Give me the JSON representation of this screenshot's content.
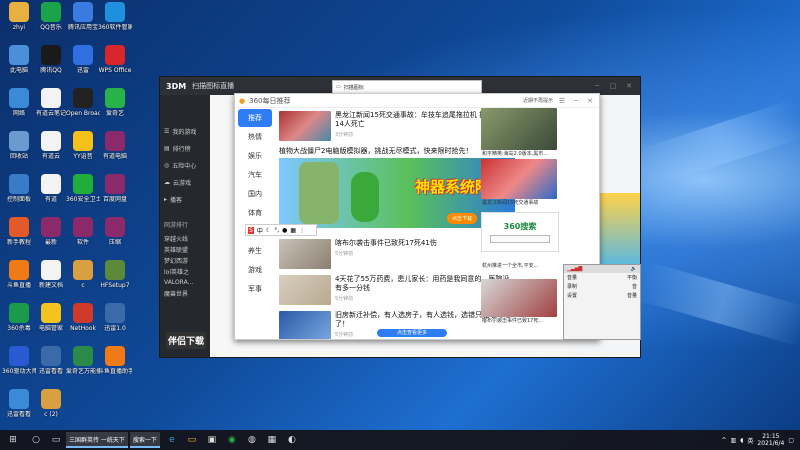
{
  "desktop": {
    "icons": [
      {
        "label": "zhyi",
        "icon": "user-folder-icon",
        "color": "#e8b040"
      },
      {
        "label": "QQ音乐",
        "icon": "qq-music-icon",
        "color": "#1aa34a"
      },
      {
        "label": "腾讯应用宝",
        "icon": "tencent-app-icon",
        "color": "#3a7be0"
      },
      {
        "label": "360软件管家",
        "icon": "360-manager-icon",
        "color": "#1f8fe0"
      },
      {
        "label": "此电脑",
        "icon": "computer-icon",
        "color": "#4a8fd8"
      },
      {
        "label": "腾讯QQ",
        "icon": "qq-icon",
        "color": "#1a1a1a"
      },
      {
        "label": "迅雷",
        "icon": "thunder-icon",
        "color": "#2f6fe0"
      },
      {
        "label": "WPS Office",
        "icon": "wps-icon",
        "color": "#d9262b"
      },
      {
        "label": "网络",
        "icon": "network-icon",
        "color": "#3a8ad8"
      },
      {
        "label": "有道云笔记",
        "icon": "document-icon",
        "color": "#f3f3f3"
      },
      {
        "label": "Open Broadcaster",
        "icon": "obs-icon",
        "color": "#222"
      },
      {
        "label": "爱奇艺",
        "icon": "iqiyi-icon",
        "color": "#28b34a"
      },
      {
        "label": "回收站",
        "icon": "recycle-bin-icon",
        "color": "#6a9ad0"
      },
      {
        "label": "有道云",
        "icon": "document-icon",
        "color": "#f3f3f3"
      },
      {
        "label": "YY语音",
        "icon": "yy-icon",
        "color": "#f3c11a"
      },
      {
        "label": "有道电脑",
        "icon": "winrar-icon",
        "color": "#8a2a6a"
      },
      {
        "label": "控制面板",
        "icon": "control-panel-icon",
        "color": "#3a7bc8"
      },
      {
        "label": "有道",
        "icon": "document-icon",
        "color": "#f3f3f3"
      },
      {
        "label": "360安全卫士",
        "icon": "360-guard-icon",
        "color": "#1fae3a"
      },
      {
        "label": "百度网盘",
        "icon": "winrar-icon",
        "color": "#8a2a6a"
      },
      {
        "label": "新手教程",
        "icon": "tutorial-icon",
        "color": "#e35a2a"
      },
      {
        "label": "最新",
        "icon": "winrar-icon",
        "color": "#8a2a6a"
      },
      {
        "label": "软件",
        "icon": "winrar-icon",
        "color": "#8a2a6a"
      },
      {
        "label": "压缩",
        "icon": "winrar-icon",
        "color": "#8a2a6a"
      },
      {
        "label": "斗鱼直播",
        "icon": "douyu-icon",
        "color": "#f07a16"
      },
      {
        "label": "新建文档",
        "icon": "document-icon",
        "color": "#f3f3f3"
      },
      {
        "label": "c",
        "icon": "app-icon",
        "color": "#d8a040"
      },
      {
        "label": "HFSetup7",
        "icon": "setup-icon",
        "color": "#5a8a3a"
      },
      {
        "label": "360杀毒",
        "icon": "360-antivirus-icon",
        "color": "#1a9a4a"
      },
      {
        "label": "电脑管家",
        "icon": "guard-icon",
        "color": "#f3c320"
      },
      {
        "label": "NetHook",
        "icon": "nethook-icon",
        "color": "#d03a2a"
      },
      {
        "label": "迅雷1.0",
        "icon": "tool-icon",
        "color": "#3a6aa8"
      },
      {
        "label": "360驱动大师",
        "icon": "360-driver-icon",
        "color": "#2a5ad0"
      },
      {
        "label": "迅雷看看",
        "icon": "tool-icon",
        "color": "#3a6aa8"
      },
      {
        "label": "爱奇艺万能播放器",
        "icon": "player-icon",
        "color": "#2a8a4a"
      },
      {
        "label": "斗鱼直播助手",
        "icon": "douyu-icon",
        "color": "#f07a16"
      },
      {
        "label": "迅雷看看",
        "icon": "browser-icon",
        "color": "#3a8ad8"
      },
      {
        "label": "c (2)",
        "icon": "app-icon",
        "color": "#d8a040"
      }
    ]
  },
  "game_window": {
    "title": "扫描图标直播",
    "logo": "3DM",
    "sidebar_items": [
      "我的游戏",
      "排行榜",
      "五险中心",
      "云游戏",
      "播客"
    ],
    "section_heading": "网游排行",
    "list_items": [
      "穿越火线",
      "英雄联盟",
      "梦幻西游",
      "lol英雄之",
      "VALORA...",
      "魔兽世界"
    ],
    "banner_text": "伴侣下载"
  },
  "mini_window": {
    "url_text": "扫描图标"
  },
  "news_window": {
    "title": "360每日推荐",
    "title_right": "近期不再提示",
    "categories": [
      "推荐",
      "热情",
      "娱乐",
      "汽车",
      "国内",
      "体育",
      "财经",
      "养生",
      "游戏",
      "军事"
    ],
    "active_category": "推荐",
    "items": [
      {
        "title": "黑龙江新闻15死交通事故：牟技车追尾拖拉机 拖拉机上14人死亡",
        "src": "3分钟前"
      },
      {
        "title": "植物大战僵尸2电脑版模拟器，挑战无尽模式，快来限时抢先！",
        "src": ""
      },
      {
        "title": "喀布尔袭击事件已致死17死41伤",
        "src": "5分钟前"
      },
      {
        "title": "4天花了55万药费，患儿家长：用药是我同意的，医院没有多一分钱",
        "src": "5分钟前"
      },
      {
        "title": "旧房新迁补偿，有人选房子，有人选钱，选错只能吃闷亏了！",
        "src": "5分钟前"
      }
    ],
    "banner_title": "神器系统降临",
    "banner_button": "点击下载",
    "right_captions": [
      "和平精英:海岛2.0版本,黑市...",
      "黑龙江新闻15死交通事故"
    ],
    "search_logo": "360搜索",
    "ticker": "杭州推进一个全市,平安...",
    "bottom_caption": "喀布尔袭击事件已致17死...",
    "load_more": "点击查看更多"
  },
  "ime_bar": {
    "label": "中"
  },
  "volume_window": {
    "rows": [
      "音量",
      "录制",
      "设置"
    ],
    "right_labels": [
      "平衡",
      "音",
      "音量"
    ]
  },
  "taskbar": {
    "search_placeholder": "三国群英传 ...",
    "task_labels": [
      "三国群英传 一统天下",
      "搜索一下"
    ],
    "clock_time": "21:15",
    "clock_date": "2021/6/4"
  }
}
